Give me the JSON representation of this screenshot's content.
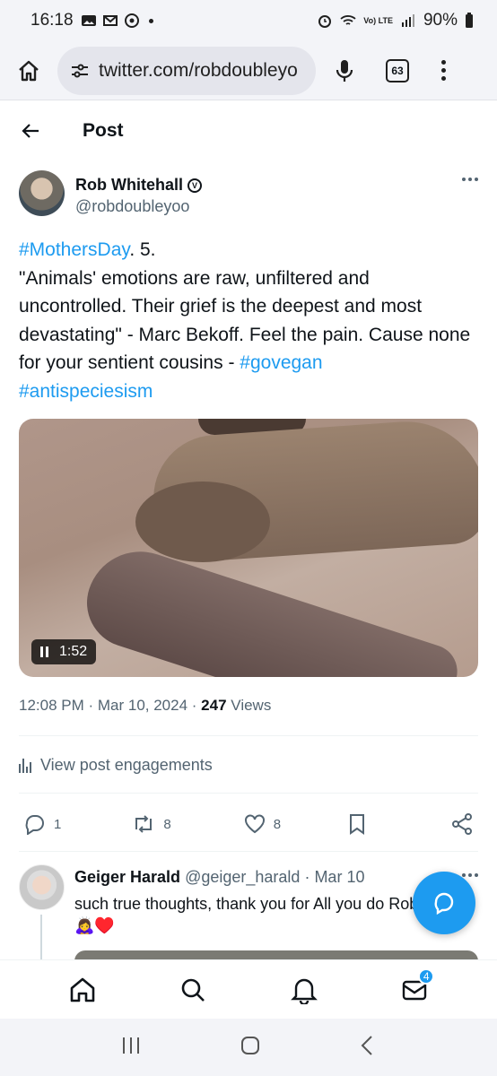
{
  "status_bar": {
    "time": "16:18",
    "battery": "90%",
    "network": "Vo) LTE"
  },
  "browser": {
    "url": "twitter.com/robdoubleyo",
    "tab_count": "63"
  },
  "header": {
    "title": "Post"
  },
  "tweet": {
    "author_name": "Rob Whitehall",
    "verified_mark": "V",
    "handle": "@robdoubleyoo",
    "text_parts": {
      "tag1": "#MothersDay",
      "body": ". 5.\n\"Animals' emotions are raw, unfiltered and uncontrolled. Their grief is the deepest and most devastating\" - Marc Bekoff. Feel the pain. Cause none for your sentient cousins - ",
      "tag2": "#govegan",
      "tag3": "#antispeciesism"
    },
    "video_duration": "1:52",
    "time": "12:08 PM",
    "date": "Mar 10, 2024",
    "views_count": "247",
    "views_label": "Views",
    "engagements_label": "View post engagements",
    "replies": "1",
    "reposts": "8",
    "likes": "8"
  },
  "reply": {
    "name": "Geiger Harald",
    "handle": "@geiger_harald",
    "date": "Mar 10",
    "text": "such true thoughts, thank you for All you do Rob. 🙇‍♀️♥️"
  },
  "bottom_nav": {
    "messages_badge": "4"
  },
  "colors": {
    "accent": "#1d9bf0",
    "text": "#0f1419",
    "secondary": "#536471"
  }
}
